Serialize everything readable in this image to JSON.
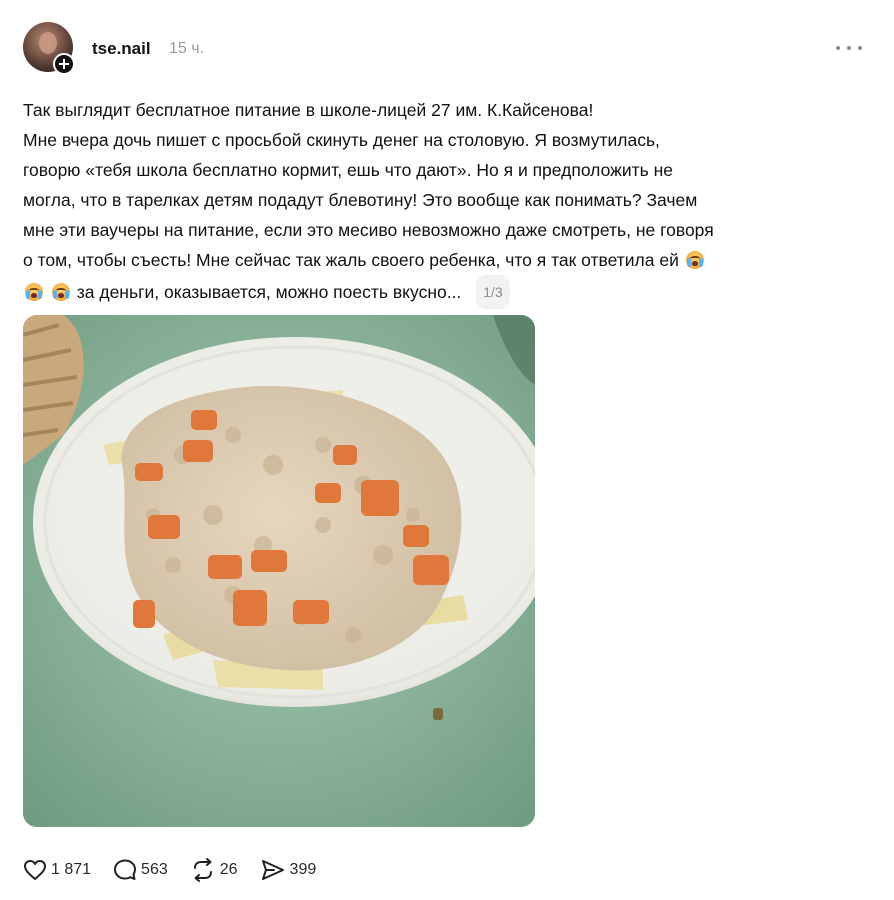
{
  "post": {
    "author": {
      "username": "tse.nail"
    },
    "timestamp": "15 ч.",
    "text_lines": [
      "Так выглядит бесплатное питание в школе-лицей 27 им. К.Кайсенова!",
      "Мне вчера дочь пишет с просьбой скинуть денег на столовую. Я возмутилась,",
      "говорю «тебя школа бесплатно кормит, ешь что дают». Но я и предположить не",
      "могла, что в тарелках детям подадут блевотину! Это вообще как понимать? Зачем",
      "мне эти ваучеры на питание, если это месиво невозможно даже смотреть, не говоря",
      "о том, чтобы съесть! Мне сейчас так жаль своего ребенка, что я так ответила ей",
      "за деньги, оказывается, можно поесть вкусно..."
    ],
    "page_counter": "1/3",
    "stats": {
      "likes": "1 871",
      "comments": "563",
      "reposts": "26",
      "shares": "399"
    }
  },
  "icons": {
    "more": "more-dots-icon",
    "like": "heart-icon",
    "comment": "comment-bubble-icon",
    "repost": "repost-icon",
    "share": "send-icon",
    "emoji": "crying-face-emoji"
  },
  "colors": {
    "muted_text": "#9a9a9a",
    "counter_bg": "#f2f2f2",
    "plate_green": "#8db69b"
  }
}
